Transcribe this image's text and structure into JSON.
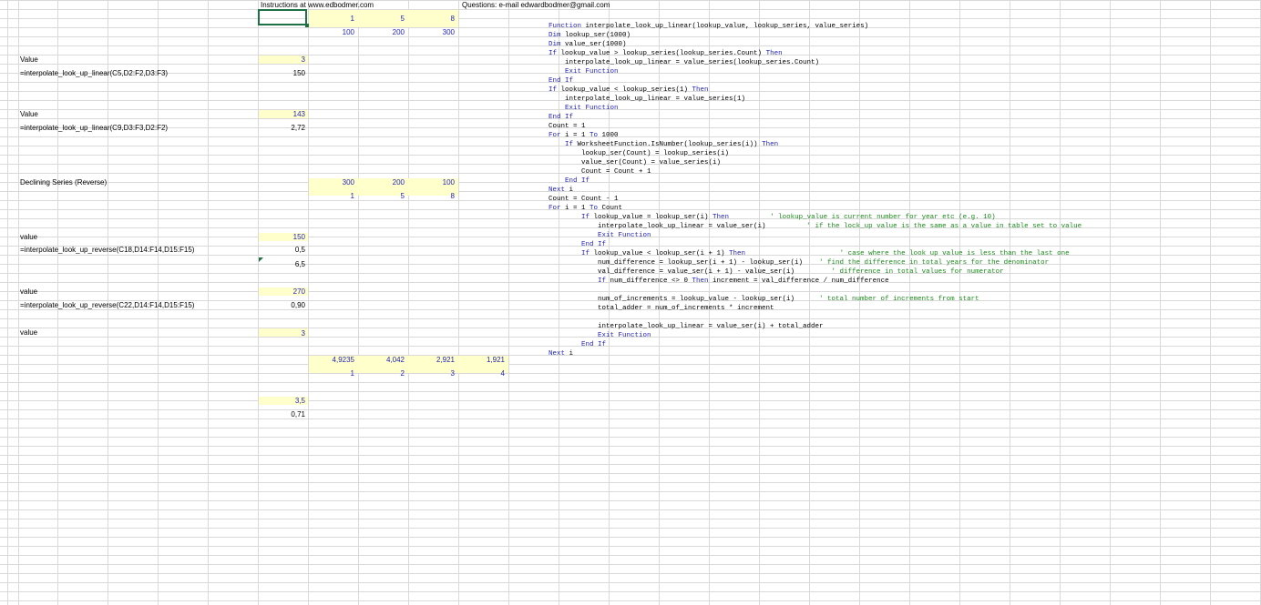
{
  "header": {
    "instructions": "Instructions at www.edbodmer.com",
    "questions": "Questions: e-mail edwardbodmer@gmail.com"
  },
  "labels": {
    "value1": "Value",
    "formula1": "=interpolate_look_up_linear(C5,D2:F2,D3:F3)",
    "value2": "Value",
    "formula2": "=interpolate_look_up_linear(C9,D3:F3,D2:F2)",
    "declining": "Declining Series (Reverse)",
    "value3": "value",
    "formula3": "=interpolate_look_up_reverse(C18,D14:F14,D15:F15)",
    "value4": "value",
    "formula4": "=interpolate_look_up_reverse(C22,D14:F14,D15:F15)",
    "value5": "value"
  },
  "cells": {
    "r2": [
      "1",
      "5",
      "8"
    ],
    "r3": [
      "100",
      "200",
      "300"
    ],
    "c5": "3",
    "c6": "150",
    "c11": "143",
    "c12": "2,72",
    "r19a": [
      "300",
      "200",
      "100"
    ],
    "r19b": [
      "1",
      "5",
      "8"
    ],
    "c25": "150",
    "c26": "0,5",
    "c28": "6,5",
    "c31": "270",
    "c32": "0,90",
    "c35": "3",
    "r38a": [
      "4,9235",
      "4,042",
      "2,921",
      "1,921"
    ],
    "r38b": [
      "1",
      "2",
      "3",
      "4"
    ],
    "c43": "3,5",
    "c44": "0,71"
  },
  "code_lines": [
    [
      {
        "t": "Function ",
        "k": "kw"
      },
      {
        "t": "interpolate_look_up_linear(lookup_value, lookup_series, value_series)"
      }
    ],
    [
      {
        "t": "Dim ",
        "k": "kw"
      },
      {
        "t": "lookup_ser(1000)"
      }
    ],
    [
      {
        "t": "Dim ",
        "k": "kw"
      },
      {
        "t": "value_ser(1000)"
      }
    ],
    [
      {
        "t": "If ",
        "k": "kw"
      },
      {
        "t": "lookup_value > lookup_series(lookup_series.Count) "
      },
      {
        "t": "Then",
        "k": "kw"
      }
    ],
    [
      {
        "t": "    interpolate_look_up_linear = value_series(lookup_series.Count)"
      }
    ],
    [
      {
        "t": "    Exit Function",
        "k": "kw"
      }
    ],
    [
      {
        "t": "End If",
        "k": "kw"
      }
    ],
    [
      {
        "t": "If ",
        "k": "kw"
      },
      {
        "t": "lookup_value < lookup_series(1) "
      },
      {
        "t": "Then",
        "k": "kw"
      }
    ],
    [
      {
        "t": "    interpolate_look_up_linear = value_series(1)"
      }
    ],
    [
      {
        "t": "    Exit Function",
        "k": "kw"
      }
    ],
    [
      {
        "t": "End If",
        "k": "kw"
      }
    ],
    [
      {
        "t": "Count = 1"
      }
    ],
    [
      {
        "t": "For ",
        "k": "kw"
      },
      {
        "t": "i = 1 "
      },
      {
        "t": "To ",
        "k": "kw"
      },
      {
        "t": "1000"
      }
    ],
    [
      {
        "t": "    If ",
        "k": "kw"
      },
      {
        "t": "WorksheetFunction.IsNumber(lookup_series(i)) "
      },
      {
        "t": "Then",
        "k": "kw"
      }
    ],
    [
      {
        "t": "        lookup_ser(Count) = lookup_series(i)"
      }
    ],
    [
      {
        "t": "        value_ser(Count) = value_series(i)"
      }
    ],
    [
      {
        "t": "        Count = Count + 1"
      }
    ],
    [
      {
        "t": "    End If",
        "k": "kw"
      }
    ],
    [
      {
        "t": "Next ",
        "k": "kw"
      },
      {
        "t": "i"
      }
    ],
    [
      {
        "t": "Count = Count - 1"
      }
    ],
    [
      {
        "t": "For ",
        "k": "kw"
      },
      {
        "t": "i = 1 "
      },
      {
        "t": "To ",
        "k": "kw"
      },
      {
        "t": "Count"
      }
    ],
    [
      {
        "t": "        If ",
        "k": "kw"
      },
      {
        "t": "lookup_value = lookup_ser(i) "
      },
      {
        "t": "Then",
        "k": "kw"
      },
      {
        "t": "          ' lookup_value is current number for year etc (e.g. 10)",
        "k": "cm"
      }
    ],
    [
      {
        "t": "            interpolate_look_up_linear = value_ser(i)"
      },
      {
        "t": "          ' if the lock_up value is the same as a value in table set to value",
        "k": "cm"
      }
    ],
    [
      {
        "t": "            Exit Function",
        "k": "kw"
      }
    ],
    [
      {
        "t": "        End If",
        "k": "kw"
      }
    ],
    [
      {
        "t": "        If ",
        "k": "kw"
      },
      {
        "t": "lookup_value < lookup_ser(i + 1) "
      },
      {
        "t": "Then",
        "k": "kw"
      },
      {
        "t": "                       ' case where the look up value is less than the last one",
        "k": "cm"
      }
    ],
    [
      {
        "t": "            num_difference = lookup_ser(i + 1) - lookup_ser(i)"
      },
      {
        "t": "    ' find the difference in total years for the denominator",
        "k": "cm"
      }
    ],
    [
      {
        "t": "            val_difference = value_ser(i + 1) - value_ser(i)"
      },
      {
        "t": "         ' difference in total values for numerator",
        "k": "cm"
      }
    ],
    [
      {
        "t": "            If ",
        "k": "kw"
      },
      {
        "t": "num_difference <> 0 "
      },
      {
        "t": "Then ",
        "k": "kw"
      },
      {
        "t": "increment = val_difference / num_difference"
      }
    ],
    [
      {
        "t": ""
      }
    ],
    [
      {
        "t": "            num_of_increments = lookup_value - lookup_ser(i)"
      },
      {
        "t": "      ' total number of increments from start",
        "k": "cm"
      }
    ],
    [
      {
        "t": "            total_adder = num_of_increments * increment"
      }
    ],
    [
      {
        "t": ""
      }
    ],
    [
      {
        "t": "            interpolate_look_up_linear = value_ser(i) + total_adder"
      }
    ],
    [
      {
        "t": "            Exit Function",
        "k": "kw"
      }
    ],
    [
      {
        "t": "        End If",
        "k": "kw"
      }
    ],
    [
      {
        "t": "Next ",
        "k": "kw"
      },
      {
        "t": "i"
      }
    ]
  ]
}
